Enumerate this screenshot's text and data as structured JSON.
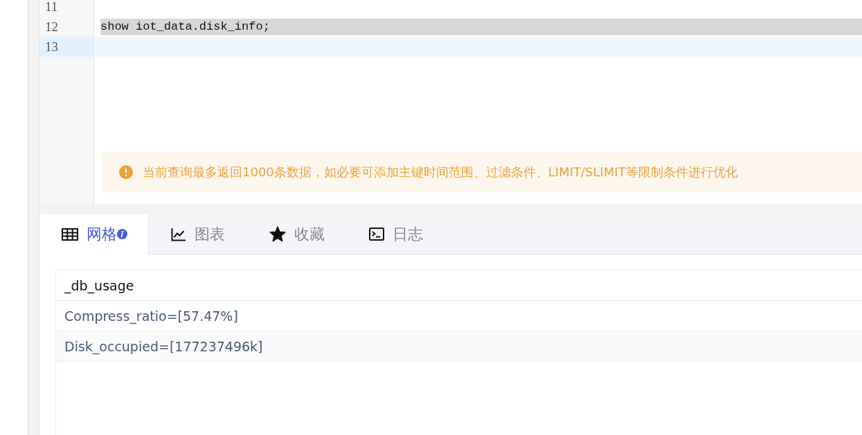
{
  "editor": {
    "lines": [
      {
        "number": "11",
        "highlighted": false,
        "current": false
      },
      {
        "number": "12",
        "text": "show iot_data.disk_info;",
        "highlighted": true,
        "current": false
      },
      {
        "number": "13",
        "highlighted": false,
        "current": true
      }
    ]
  },
  "notice": {
    "kind": "warning",
    "text": "当前查询最多返回1000条数据，如必要可添加主键时间范围、过滤条件、LIMIT/SLIMIT等限制条件进行优化"
  },
  "tabs": [
    {
      "label": "网格",
      "kind": "grid",
      "info": true,
      "selected": true
    },
    {
      "label": "图表",
      "kind": "chart",
      "info": false,
      "selected": false
    },
    {
      "label": "收藏",
      "kind": "star",
      "info": false,
      "selected": false
    },
    {
      "label": "日志",
      "kind": "terminal",
      "info": false,
      "selected": false
    }
  ],
  "table": {
    "columns": [
      "_db_usage"
    ],
    "rows": [
      {
        "cells": [
          "Compress_ratio=[57.47%]"
        ]
      },
      {
        "cells": [
          "Disk_occupied=[177237496k]"
        ]
      }
    ]
  }
}
